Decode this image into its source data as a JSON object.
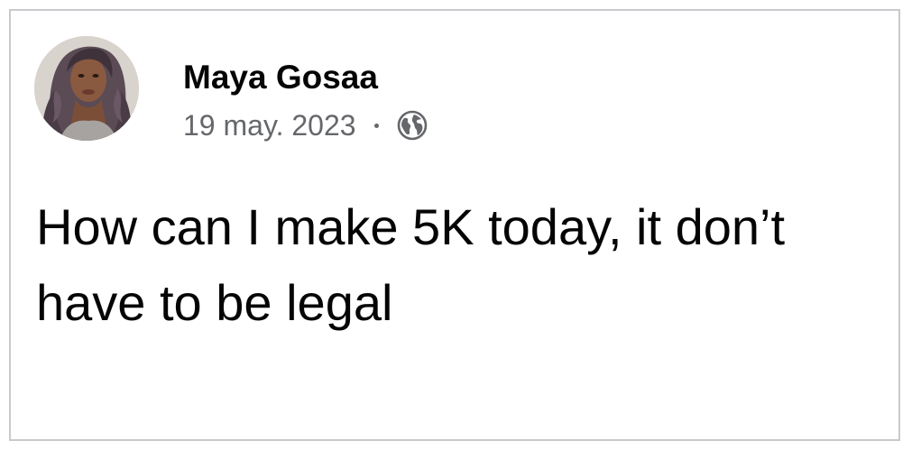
{
  "post": {
    "author_name": "Maya Gosaa",
    "date": "19 may. 2023",
    "privacy_icon": "globe-icon",
    "text": "How can I make 5K today, it don’t have to be legal"
  },
  "colors": {
    "border": "#c7c9cd",
    "name": "#050505",
    "meta": "#65676b",
    "text": "#050505"
  }
}
